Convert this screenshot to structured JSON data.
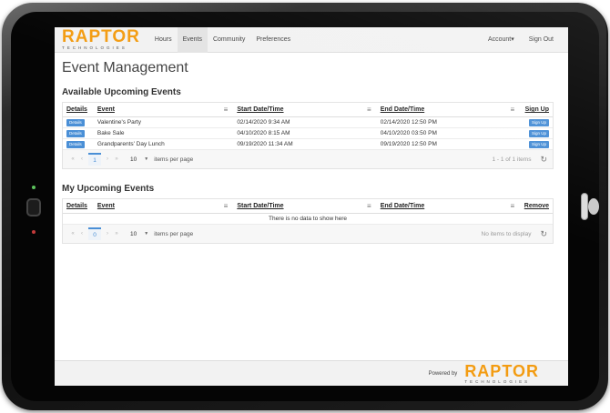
{
  "brand": {
    "name": "RAPTOR",
    "sub": "TECHNOLOGIES",
    "color": "#f39c12"
  },
  "nav": {
    "items": [
      {
        "label": "Hours",
        "active": false
      },
      {
        "label": "Events",
        "active": true
      },
      {
        "label": "Community",
        "active": false
      },
      {
        "label": "Preferences",
        "active": false
      }
    ],
    "account": "Account▾",
    "signout": "Sign Out"
  },
  "page_title": "Event Management",
  "available": {
    "title": "Available Upcoming Events",
    "headers": {
      "details": "Details",
      "event": "Event",
      "start": "Start Date/Time",
      "end": "End Date/Time",
      "action": "Sign Up"
    },
    "rows": [
      {
        "details": "Details",
        "event": "Valentine's Party",
        "start": "02/14/2020 9:34 AM",
        "end": "02/14/2020 12:50 PM",
        "action": "Sign Up"
      },
      {
        "details": "Details",
        "event": "Bake Sale",
        "start": "04/10/2020 8:15 AM",
        "end": "04/10/2020 03:50 PM",
        "action": "Sign Up"
      },
      {
        "details": "Details",
        "event": "Grandparents' Day Lunch",
        "start": "09/19/2020 11:34 AM",
        "end": "09/19/2020 12:50 PM",
        "action": "Sign Up"
      }
    ],
    "pager": {
      "page": "1",
      "page_size": "10",
      "items_per_page": "items per page",
      "info": "1 - 1 of 1 items"
    }
  },
  "mine": {
    "title": "My Upcoming Events",
    "headers": {
      "details": "Details",
      "event": "Event",
      "start": "Start Date/Time",
      "end": "End Date/Time",
      "action": "Remove"
    },
    "empty": "There is no data to show here",
    "pager": {
      "page": "0",
      "page_size": "10",
      "items_per_page": "items per page",
      "info": "No items to display"
    }
  },
  "footer": {
    "powered": "Powered by"
  },
  "icons": {
    "menu": "hamburger-menu-icon",
    "refresh": "refresh-icon",
    "first": "first-page-icon",
    "prev": "prev-page-icon",
    "next": "next-page-icon",
    "last": "last-page-icon"
  }
}
